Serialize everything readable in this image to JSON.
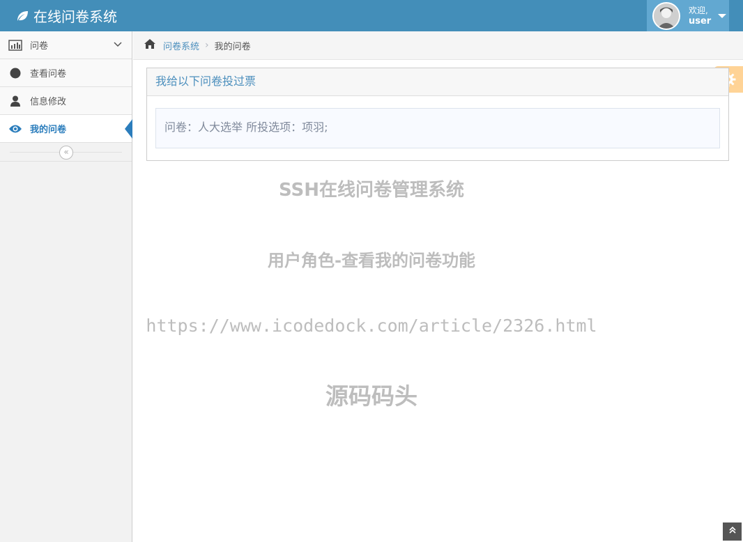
{
  "navbar": {
    "brand": "在线问卷系统",
    "welcome": "欢迎,",
    "username": "user"
  },
  "sidebar": {
    "items": [
      {
        "label": "问卷",
        "icon": "bar-chart-icon"
      },
      {
        "label": "查看问卷",
        "icon": "circle-icon"
      },
      {
        "label": "信息修改",
        "icon": "user-icon"
      },
      {
        "label": "我的问卷",
        "icon": "eye-icon",
        "active": true
      }
    ],
    "collapse_icon": "«"
  },
  "breadcrumb": {
    "home": "问卷系统",
    "current": "我的问卷"
  },
  "panel": {
    "title": "我给以下问卷投过票",
    "entry": "问卷：人大选举  所投选项：项羽;"
  },
  "watermark": {
    "line1": "SSH在线问卷管理系统",
    "line2": "用户角色-查看我的问卷功能",
    "line3": "https://www.icodedock.com/article/2326.html",
    "line4": "源码码头"
  },
  "scroll_top_icon": "»",
  "colors": {
    "navbar": "#438eb9",
    "user_menu": "#62a8d1",
    "active": "#2b7dbc",
    "settings": "#ffb752"
  }
}
